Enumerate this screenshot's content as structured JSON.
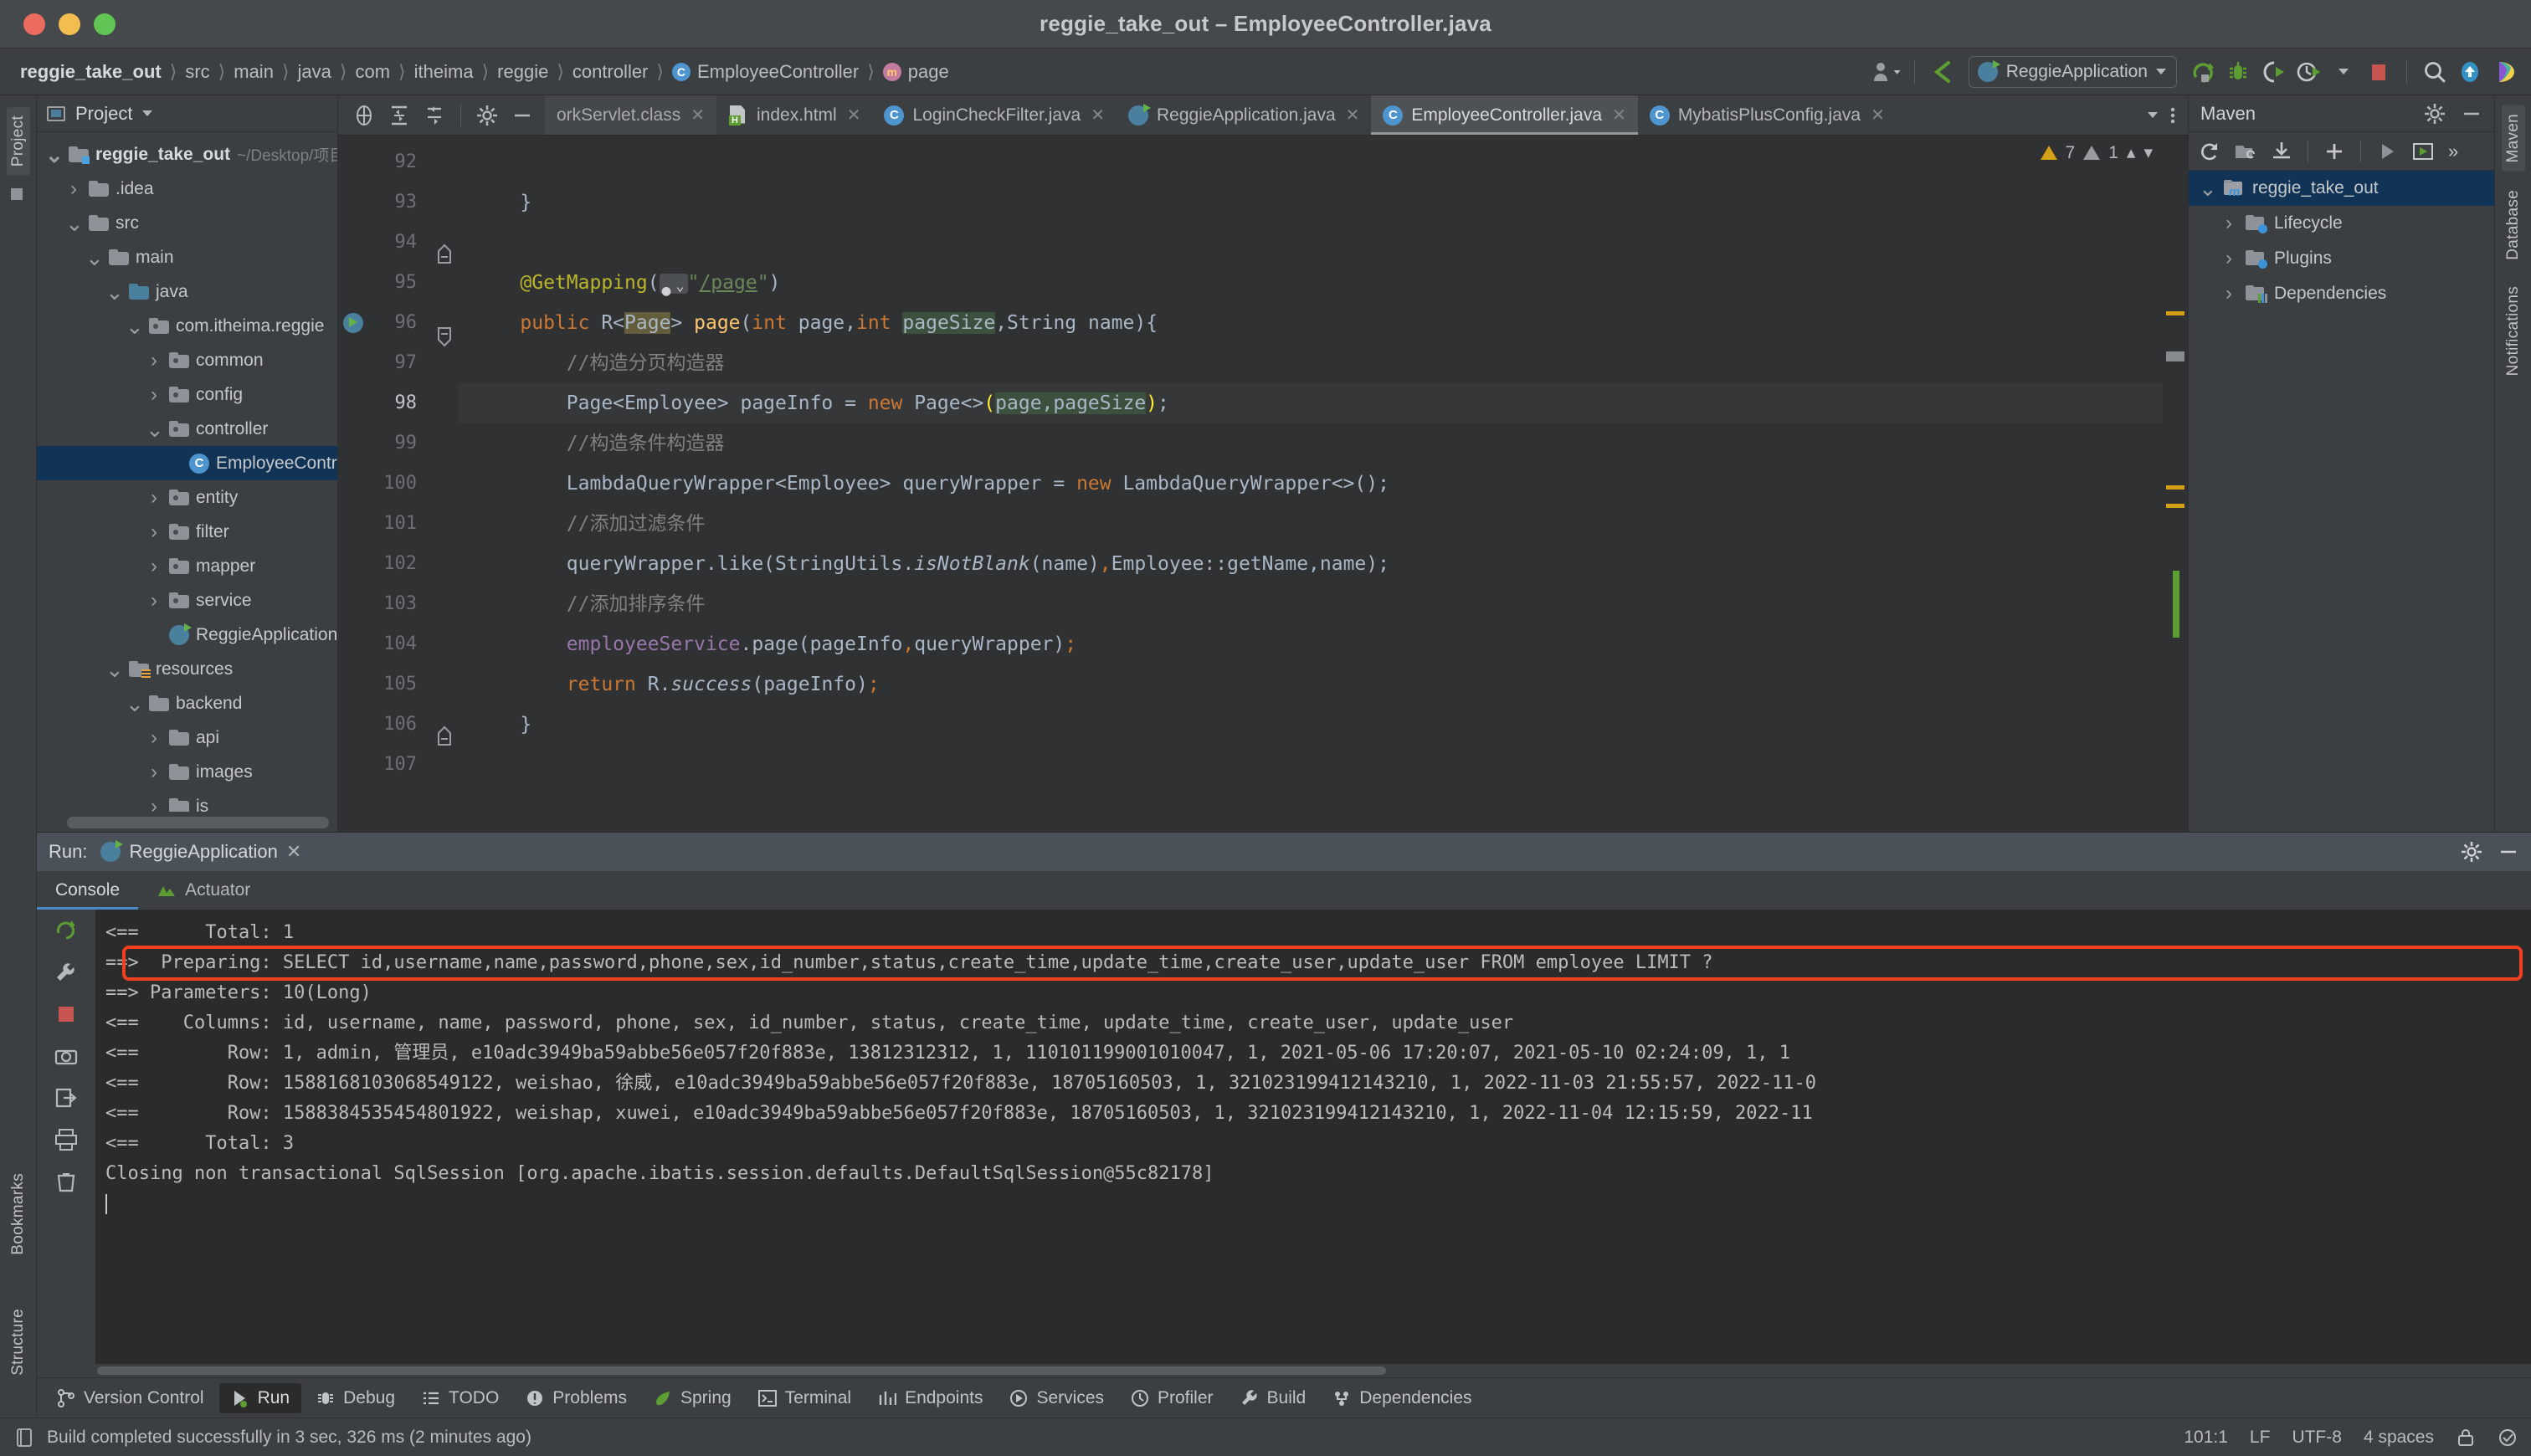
{
  "window": {
    "title": "reggie_take_out – EmployeeController.java",
    "traffic_lights": [
      "close",
      "minimize",
      "maximize"
    ]
  },
  "breadcrumbs": [
    {
      "label": "reggie_take_out",
      "icon": "project-root"
    },
    {
      "label": "src",
      "icon": ""
    },
    {
      "label": "main",
      "icon": ""
    },
    {
      "label": "java",
      "icon": ""
    },
    {
      "label": "com",
      "icon": ""
    },
    {
      "label": "itheima",
      "icon": ""
    },
    {
      "label": "reggie",
      "icon": ""
    },
    {
      "label": "controller",
      "icon": ""
    },
    {
      "label": "EmployeeController",
      "icon": "class-icon"
    },
    {
      "label": "page",
      "icon": "method-icon"
    }
  ],
  "toolbar": {
    "profile_icon": "user-icon",
    "back_icon": "back-arrow-icon",
    "run_config": "ReggieApplication",
    "run_icon": "run-icon",
    "debug_icon": "debug-icon",
    "run_coverage_icon": "run-with-coverage-icon",
    "profiler_icon": "profiler-icon",
    "stop_icon": "stop-icon",
    "search_icon": "search-icon",
    "update_icon": "update-project-icon",
    "ai_icon": "ai-assistant-icon"
  },
  "left_strip": {
    "tabs": [
      "Project"
    ],
    "bookmarks": "Bookmarks",
    "structure": "Structure"
  },
  "project_panel": {
    "title": "Project",
    "dropdown_icon": "chevron-down-icon",
    "tree": [
      {
        "label": "reggie_take_out",
        "note": "~/Desktop/项目/reggie_tak",
        "depth": 0,
        "arrow": "down",
        "icon": "module-folder",
        "bold": true,
        "selected": false
      },
      {
        "label": ".idea",
        "note": "",
        "depth": 1,
        "arrow": "right",
        "icon": "folder",
        "bold": false,
        "selected": false
      },
      {
        "label": "src",
        "note": "",
        "depth": 1,
        "arrow": "down",
        "icon": "folder",
        "bold": false,
        "selected": false
      },
      {
        "label": "main",
        "note": "",
        "depth": 2,
        "arrow": "down",
        "icon": "folder",
        "bold": false,
        "selected": false
      },
      {
        "label": "java",
        "note": "",
        "depth": 3,
        "arrow": "down",
        "icon": "source-folder",
        "bold": false,
        "selected": false
      },
      {
        "label": "com.itheima.reggie",
        "note": "",
        "depth": 4,
        "arrow": "down",
        "icon": "package",
        "bold": false,
        "selected": false
      },
      {
        "label": "common",
        "note": "",
        "depth": 5,
        "arrow": "right",
        "icon": "package",
        "bold": false,
        "selected": false
      },
      {
        "label": "config",
        "note": "",
        "depth": 5,
        "arrow": "right",
        "icon": "package",
        "bold": false,
        "selected": false
      },
      {
        "label": "controller",
        "note": "",
        "depth": 5,
        "arrow": "down",
        "icon": "package",
        "bold": false,
        "selected": false
      },
      {
        "label": "EmployeeController",
        "note": "",
        "depth": 6,
        "arrow": "none",
        "icon": "java-class",
        "bold": false,
        "selected": true
      },
      {
        "label": "entity",
        "note": "",
        "depth": 5,
        "arrow": "right",
        "icon": "package",
        "bold": false,
        "selected": false
      },
      {
        "label": "filter",
        "note": "",
        "depth": 5,
        "arrow": "right",
        "icon": "package",
        "bold": false,
        "selected": false
      },
      {
        "label": "mapper",
        "note": "",
        "depth": 5,
        "arrow": "right",
        "icon": "package",
        "bold": false,
        "selected": false
      },
      {
        "label": "service",
        "note": "",
        "depth": 5,
        "arrow": "right",
        "icon": "package",
        "bold": false,
        "selected": false
      },
      {
        "label": "ReggieApplication",
        "note": "",
        "depth": 5,
        "arrow": "none",
        "icon": "spring-class",
        "bold": false,
        "selected": false
      },
      {
        "label": "resources",
        "note": "",
        "depth": 3,
        "arrow": "down",
        "icon": "resources-folder",
        "bold": false,
        "selected": false
      },
      {
        "label": "backend",
        "note": "",
        "depth": 4,
        "arrow": "down",
        "icon": "folder",
        "bold": false,
        "selected": false
      },
      {
        "label": "api",
        "note": "",
        "depth": 5,
        "arrow": "right",
        "icon": "folder",
        "bold": false,
        "selected": false
      },
      {
        "label": "images",
        "note": "",
        "depth": 5,
        "arrow": "right",
        "icon": "folder",
        "bold": false,
        "selected": false
      },
      {
        "label": "js",
        "note": "",
        "depth": 5,
        "arrow": "right",
        "icon": "folder",
        "bold": false,
        "selected": false
      }
    ]
  },
  "editor": {
    "tab_tools": [
      "expand-all-icon",
      "collapse-all-icon",
      "settings-gear-icon",
      "hide-icon"
    ],
    "tabs": [
      {
        "label": "orkServlet.class",
        "icon": "class-file-icon",
        "active": false,
        "truncated": true
      },
      {
        "label": "index.html",
        "icon": "html-file-icon",
        "active": false,
        "truncated": false
      },
      {
        "label": "LoginCheckFilter.java",
        "icon": "java-class-icon",
        "active": false,
        "truncated": false
      },
      {
        "label": "ReggieApplication.java",
        "icon": "spring-class-icon",
        "active": false,
        "truncated": false
      },
      {
        "label": "EmployeeController.java",
        "icon": "java-class-icon",
        "active": true,
        "truncated": false
      },
      {
        "label": "MybatisPlusConfig.java",
        "icon": "java-class-icon",
        "active": false,
        "truncated": false
      }
    ],
    "tab_overflow_icon": "chevron-down-icon",
    "tab_menu_icon": "more-options-icon",
    "inspection": {
      "warnings": "7",
      "weak_warnings": "1",
      "up_icon": "chevron-up-icon",
      "down_icon": "chevron-down-icon"
    },
    "first_line": 92,
    "lines": [
      {
        "no": 92,
        "text": "",
        "current": false
      },
      {
        "no": 93,
        "text": "    }",
        "current": false
      },
      {
        "no": 94,
        "text": "",
        "current": false
      },
      {
        "no": 95,
        "text": "    @GetMapping(\"/page\")",
        "current": false
      },
      {
        "no": 96,
        "text": "    public R<Page> page(int page,int pageSize,String name){",
        "current": false
      },
      {
        "no": 97,
        "text": "        //构造分页构造器",
        "current": false
      },
      {
        "no": 98,
        "text": "        Page<Employee> pageInfo = new Page<>(page,pageSize);",
        "current": true
      },
      {
        "no": 99,
        "text": "        //构造条件构造器",
        "current": false
      },
      {
        "no": 100,
        "text": "        LambdaQueryWrapper<Employee> queryWrapper = new LambdaQueryWrapper<>();",
        "current": false
      },
      {
        "no": 101,
        "text": "        //添加过滤条件",
        "current": false
      },
      {
        "no": 102,
        "text": "        queryWrapper.like(StringUtils.isNotBlank(name),Employee::getName,name);",
        "current": false
      },
      {
        "no": 103,
        "text": "        //添加排序条件",
        "current": false
      },
      {
        "no": 104,
        "text": "        employeeService.page(pageInfo,queryWrapper);",
        "current": false
      },
      {
        "no": 105,
        "text": "        return R.success(pageInfo);",
        "current": false
      },
      {
        "no": 106,
        "text": "    }",
        "current": false
      },
      {
        "no": 107,
        "text": "",
        "current": false
      }
    ]
  },
  "maven_panel": {
    "title": "Maven",
    "settings_icon": "gear-icon",
    "hide_icon": "minimize-icon",
    "tools": [
      "reload-icon",
      "generate-sources-icon",
      "download-sources-icon",
      "add-icon",
      "run-icon",
      "execute-goal-icon",
      "more-icon"
    ],
    "tree": [
      {
        "label": "reggie_take_out",
        "depth": 0,
        "arrow": "down",
        "icon": "maven-project",
        "selected": true
      },
      {
        "label": "Lifecycle",
        "depth": 1,
        "arrow": "right",
        "icon": "lifecycle-folder",
        "selected": false
      },
      {
        "label": "Plugins",
        "depth": 1,
        "arrow": "right",
        "icon": "plugins-folder",
        "selected": false
      },
      {
        "label": "Dependencies",
        "depth": 1,
        "arrow": "right",
        "icon": "dependencies-folder",
        "selected": false
      }
    ]
  },
  "right_strip": {
    "tabs": [
      "Maven",
      "Database",
      "Notifications"
    ]
  },
  "run_panel": {
    "label": "Run:",
    "config_name": "ReggieApplication",
    "close_icon": "close-icon",
    "settings_icon": "gear-icon",
    "hide_icon": "minimize-icon",
    "tabs": [
      {
        "label": "Console",
        "icon": "",
        "active": true
      },
      {
        "label": "Actuator",
        "icon": "actuator-icon",
        "active": false
      }
    ],
    "side_tools": [
      "rerun-icon",
      "stop-icon",
      "camera-icon",
      "export-icon",
      "print-icon",
      "trash-icon",
      "up-arrow-icon",
      "down-arrow-icon",
      "soft-wrap-icon",
      "scroll-to-end-icon"
    ],
    "console_lines": [
      "<==      Total: 1",
      "==>  Preparing: SELECT id,username,name,password,phone,sex,id_number,status,create_time,update_time,create_user,update_user FROM employee LIMIT ?",
      "==> Parameters: 10(Long)",
      "<==    Columns: id, username, name, password, phone, sex, id_number, status, create_time, update_time, create_user, update_user",
      "<==        Row: 1, admin, 管理员, e10adc3949ba59abbe56e057f20f883e, 13812312312, 1, 110101199001010047, 1, 2021-05-06 17:20:07, 2021-05-10 02:24:09, 1, 1",
      "<==        Row: 1588168103068549122, weishao, 徐威, e10adc3949ba59abbe56e057f20f883e, 18705160503, 1, 321023199412143210, 1, 2022-11-03 21:55:57, 2022-11-0",
      "<==        Row: 1588384535454801922, weishap, xuwei, e10adc3949ba59abbe56e057f20f883e, 18705160503, 1, 321023199412143210, 1, 2022-11-04 12:15:59, 2022-11",
      "<==      Total: 3",
      "Closing non transactional SqlSession [org.apache.ibatis.session.defaults.DefaultSqlSession@55c82178]"
    ],
    "highlighted_line_index": 1,
    "highlight_color": "#f04020"
  },
  "toolwindow_bar": {
    "items": [
      {
        "label": "Version Control",
        "icon": "vcs-icon",
        "active": false
      },
      {
        "label": "Run",
        "icon": "run-icon",
        "active": true
      },
      {
        "label": "Debug",
        "icon": "debug-icon",
        "active": false
      },
      {
        "label": "TODO",
        "icon": "todo-icon",
        "active": false
      },
      {
        "label": "Problems",
        "icon": "problems-icon",
        "active": false
      },
      {
        "label": "Spring",
        "icon": "spring-icon",
        "active": false
      },
      {
        "label": "Terminal",
        "icon": "terminal-icon",
        "active": false
      },
      {
        "label": "Endpoints",
        "icon": "endpoints-icon",
        "active": false
      },
      {
        "label": "Services",
        "icon": "services-icon",
        "active": false
      },
      {
        "label": "Profiler",
        "icon": "profiler-icon",
        "active": false
      },
      {
        "label": "Build",
        "icon": "build-icon",
        "active": false
      },
      {
        "label": "Dependencies",
        "icon": "dependencies-icon",
        "active": false
      }
    ]
  },
  "statusbar": {
    "build_icon": "build-status-icon",
    "message": "Build completed successfully in 3 sec, 326 ms (2 minutes ago)",
    "caret_position": "101:1",
    "line_separator": "LF",
    "encoding": "UTF-8",
    "indent": "4 spaces",
    "lock_icon": "read-only-icon",
    "inspections_icon": "inspections-icon"
  }
}
